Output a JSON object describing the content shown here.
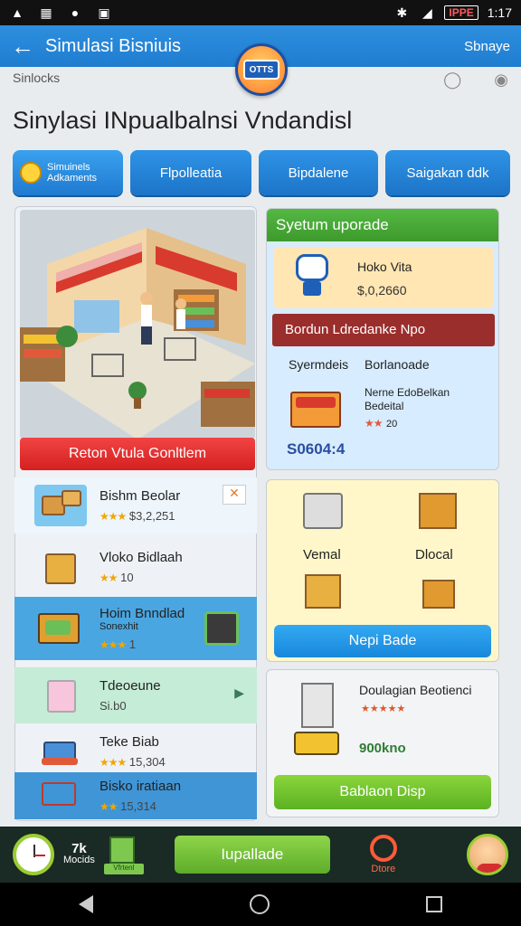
{
  "status_bar": {
    "time": "1:17",
    "battery": "IPPE"
  },
  "app_bar": {
    "title": "Simulasi Bisniuis",
    "action": "Sbnaye",
    "logo_text": "OTTS"
  },
  "subtitle": "Sinlocks",
  "heading": "Sinylasi INpualbalnsi Vndandisl",
  "tabs": [
    {
      "label": "Simuinels Adkaments",
      "active": true
    },
    {
      "label": "Flpolleatia"
    },
    {
      "label": "Bipdalene"
    },
    {
      "label": "Saigakan ddk"
    }
  ],
  "scene": {
    "button": "Reton Vtula Gonltlem"
  },
  "items": [
    {
      "name": "Bishm Beolar",
      "rating": "★★★",
      "price": "$3,2,251"
    },
    {
      "name": "Vloko Bidlaah",
      "rating": "★★",
      "price": "10"
    },
    {
      "name": "Hoim Bnndlad",
      "subtitle": "Sonexhit",
      "rating": "★★★",
      "price": "1"
    },
    {
      "name": "Tdeoeune",
      "price": "Si.b0"
    },
    {
      "name": "Teke Biab",
      "rating": "★★★",
      "price": "15,304"
    },
    {
      "name": "Bisko iratiaan",
      "rating": "★★",
      "price": "15,314"
    }
  ],
  "upgrade_panel": {
    "header": "Syetum uporade",
    "promo_name": "Hoko Vita",
    "promo_price": "$,0,2660",
    "bar_header": "Bordun Ldredanke Npo",
    "col1": "Syermdeis",
    "col2": "Borlanoade",
    "shop_name_line1": "Nerne EdoBelkan",
    "shop_name_line2": "Bedeital",
    "shop_rating": "★★",
    "shop_rating_value": "20",
    "total": "S0604:4"
  },
  "warehouse_panel": {
    "label_left": "Vemal",
    "label_right": "Dlocal",
    "button": "Nepi Bade"
  },
  "delivery_panel": {
    "title": "Doulagian Beotienci",
    "rating": "★★★★★",
    "value": "900kno",
    "button": "Bablaon Disp"
  },
  "bottom_bar": {
    "stat_big": "7k",
    "stat_small": "Mocids",
    "green_label": "Vfrtenl",
    "main_button": "Iupallade",
    "store_label": "Dtore"
  },
  "colors": {
    "primary": "#1f7dd0",
    "green": "#5cb222",
    "red": "#d42020",
    "accent_orange": "#ff7b2c"
  }
}
